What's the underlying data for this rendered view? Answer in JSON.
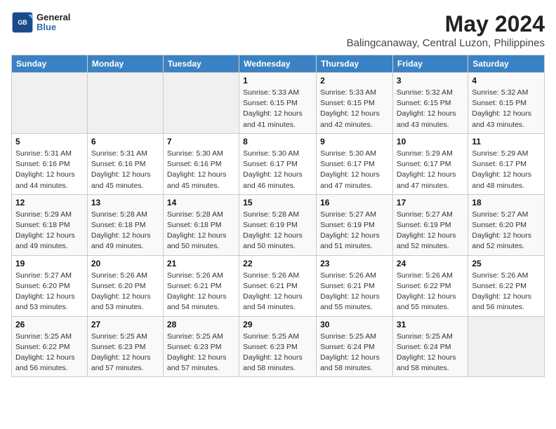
{
  "header": {
    "logo_line1": "General",
    "logo_line2": "Blue",
    "main_title": "May 2024",
    "subtitle": "Balingcanaway, Central Luzon, Philippines"
  },
  "weekdays": [
    "Sunday",
    "Monday",
    "Tuesday",
    "Wednesday",
    "Thursday",
    "Friday",
    "Saturday"
  ],
  "weeks": [
    [
      {
        "day": "",
        "sunrise": "",
        "sunset": "",
        "daylight": ""
      },
      {
        "day": "",
        "sunrise": "",
        "sunset": "",
        "daylight": ""
      },
      {
        "day": "",
        "sunrise": "",
        "sunset": "",
        "daylight": ""
      },
      {
        "day": "1",
        "sunrise": "Sunrise: 5:33 AM",
        "sunset": "Sunset: 6:15 PM",
        "daylight": "Daylight: 12 hours and 41 minutes."
      },
      {
        "day": "2",
        "sunrise": "Sunrise: 5:33 AM",
        "sunset": "Sunset: 6:15 PM",
        "daylight": "Daylight: 12 hours and 42 minutes."
      },
      {
        "day": "3",
        "sunrise": "Sunrise: 5:32 AM",
        "sunset": "Sunset: 6:15 PM",
        "daylight": "Daylight: 12 hours and 43 minutes."
      },
      {
        "day": "4",
        "sunrise": "Sunrise: 5:32 AM",
        "sunset": "Sunset: 6:15 PM",
        "daylight": "Daylight: 12 hours and 43 minutes."
      }
    ],
    [
      {
        "day": "5",
        "sunrise": "Sunrise: 5:31 AM",
        "sunset": "Sunset: 6:16 PM",
        "daylight": "Daylight: 12 hours and 44 minutes."
      },
      {
        "day": "6",
        "sunrise": "Sunrise: 5:31 AM",
        "sunset": "Sunset: 6:16 PM",
        "daylight": "Daylight: 12 hours and 45 minutes."
      },
      {
        "day": "7",
        "sunrise": "Sunrise: 5:30 AM",
        "sunset": "Sunset: 6:16 PM",
        "daylight": "Daylight: 12 hours and 45 minutes."
      },
      {
        "day": "8",
        "sunrise": "Sunrise: 5:30 AM",
        "sunset": "Sunset: 6:17 PM",
        "daylight": "Daylight: 12 hours and 46 minutes."
      },
      {
        "day": "9",
        "sunrise": "Sunrise: 5:30 AM",
        "sunset": "Sunset: 6:17 PM",
        "daylight": "Daylight: 12 hours and 47 minutes."
      },
      {
        "day": "10",
        "sunrise": "Sunrise: 5:29 AM",
        "sunset": "Sunset: 6:17 PM",
        "daylight": "Daylight: 12 hours and 47 minutes."
      },
      {
        "day": "11",
        "sunrise": "Sunrise: 5:29 AM",
        "sunset": "Sunset: 6:17 PM",
        "daylight": "Daylight: 12 hours and 48 minutes."
      }
    ],
    [
      {
        "day": "12",
        "sunrise": "Sunrise: 5:29 AM",
        "sunset": "Sunset: 6:18 PM",
        "daylight": "Daylight: 12 hours and 49 minutes."
      },
      {
        "day": "13",
        "sunrise": "Sunrise: 5:28 AM",
        "sunset": "Sunset: 6:18 PM",
        "daylight": "Daylight: 12 hours and 49 minutes."
      },
      {
        "day": "14",
        "sunrise": "Sunrise: 5:28 AM",
        "sunset": "Sunset: 6:18 PM",
        "daylight": "Daylight: 12 hours and 50 minutes."
      },
      {
        "day": "15",
        "sunrise": "Sunrise: 5:28 AM",
        "sunset": "Sunset: 6:19 PM",
        "daylight": "Daylight: 12 hours and 50 minutes."
      },
      {
        "day": "16",
        "sunrise": "Sunrise: 5:27 AM",
        "sunset": "Sunset: 6:19 PM",
        "daylight": "Daylight: 12 hours and 51 minutes."
      },
      {
        "day": "17",
        "sunrise": "Sunrise: 5:27 AM",
        "sunset": "Sunset: 6:19 PM",
        "daylight": "Daylight: 12 hours and 52 minutes."
      },
      {
        "day": "18",
        "sunrise": "Sunrise: 5:27 AM",
        "sunset": "Sunset: 6:20 PM",
        "daylight": "Daylight: 12 hours and 52 minutes."
      }
    ],
    [
      {
        "day": "19",
        "sunrise": "Sunrise: 5:27 AM",
        "sunset": "Sunset: 6:20 PM",
        "daylight": "Daylight: 12 hours and 53 minutes."
      },
      {
        "day": "20",
        "sunrise": "Sunrise: 5:26 AM",
        "sunset": "Sunset: 6:20 PM",
        "daylight": "Daylight: 12 hours and 53 minutes."
      },
      {
        "day": "21",
        "sunrise": "Sunrise: 5:26 AM",
        "sunset": "Sunset: 6:21 PM",
        "daylight": "Daylight: 12 hours and 54 minutes."
      },
      {
        "day": "22",
        "sunrise": "Sunrise: 5:26 AM",
        "sunset": "Sunset: 6:21 PM",
        "daylight": "Daylight: 12 hours and 54 minutes."
      },
      {
        "day": "23",
        "sunrise": "Sunrise: 5:26 AM",
        "sunset": "Sunset: 6:21 PM",
        "daylight": "Daylight: 12 hours and 55 minutes."
      },
      {
        "day": "24",
        "sunrise": "Sunrise: 5:26 AM",
        "sunset": "Sunset: 6:22 PM",
        "daylight": "Daylight: 12 hours and 55 minutes."
      },
      {
        "day": "25",
        "sunrise": "Sunrise: 5:26 AM",
        "sunset": "Sunset: 6:22 PM",
        "daylight": "Daylight: 12 hours and 56 minutes."
      }
    ],
    [
      {
        "day": "26",
        "sunrise": "Sunrise: 5:25 AM",
        "sunset": "Sunset: 6:22 PM",
        "daylight": "Daylight: 12 hours and 56 minutes."
      },
      {
        "day": "27",
        "sunrise": "Sunrise: 5:25 AM",
        "sunset": "Sunset: 6:23 PM",
        "daylight": "Daylight: 12 hours and 57 minutes."
      },
      {
        "day": "28",
        "sunrise": "Sunrise: 5:25 AM",
        "sunset": "Sunset: 6:23 PM",
        "daylight": "Daylight: 12 hours and 57 minutes."
      },
      {
        "day": "29",
        "sunrise": "Sunrise: 5:25 AM",
        "sunset": "Sunset: 6:23 PM",
        "daylight": "Daylight: 12 hours and 58 minutes."
      },
      {
        "day": "30",
        "sunrise": "Sunrise: 5:25 AM",
        "sunset": "Sunset: 6:24 PM",
        "daylight": "Daylight: 12 hours and 58 minutes."
      },
      {
        "day": "31",
        "sunrise": "Sunrise: 5:25 AM",
        "sunset": "Sunset: 6:24 PM",
        "daylight": "Daylight: 12 hours and 58 minutes."
      },
      {
        "day": "",
        "sunrise": "",
        "sunset": "",
        "daylight": ""
      }
    ]
  ]
}
